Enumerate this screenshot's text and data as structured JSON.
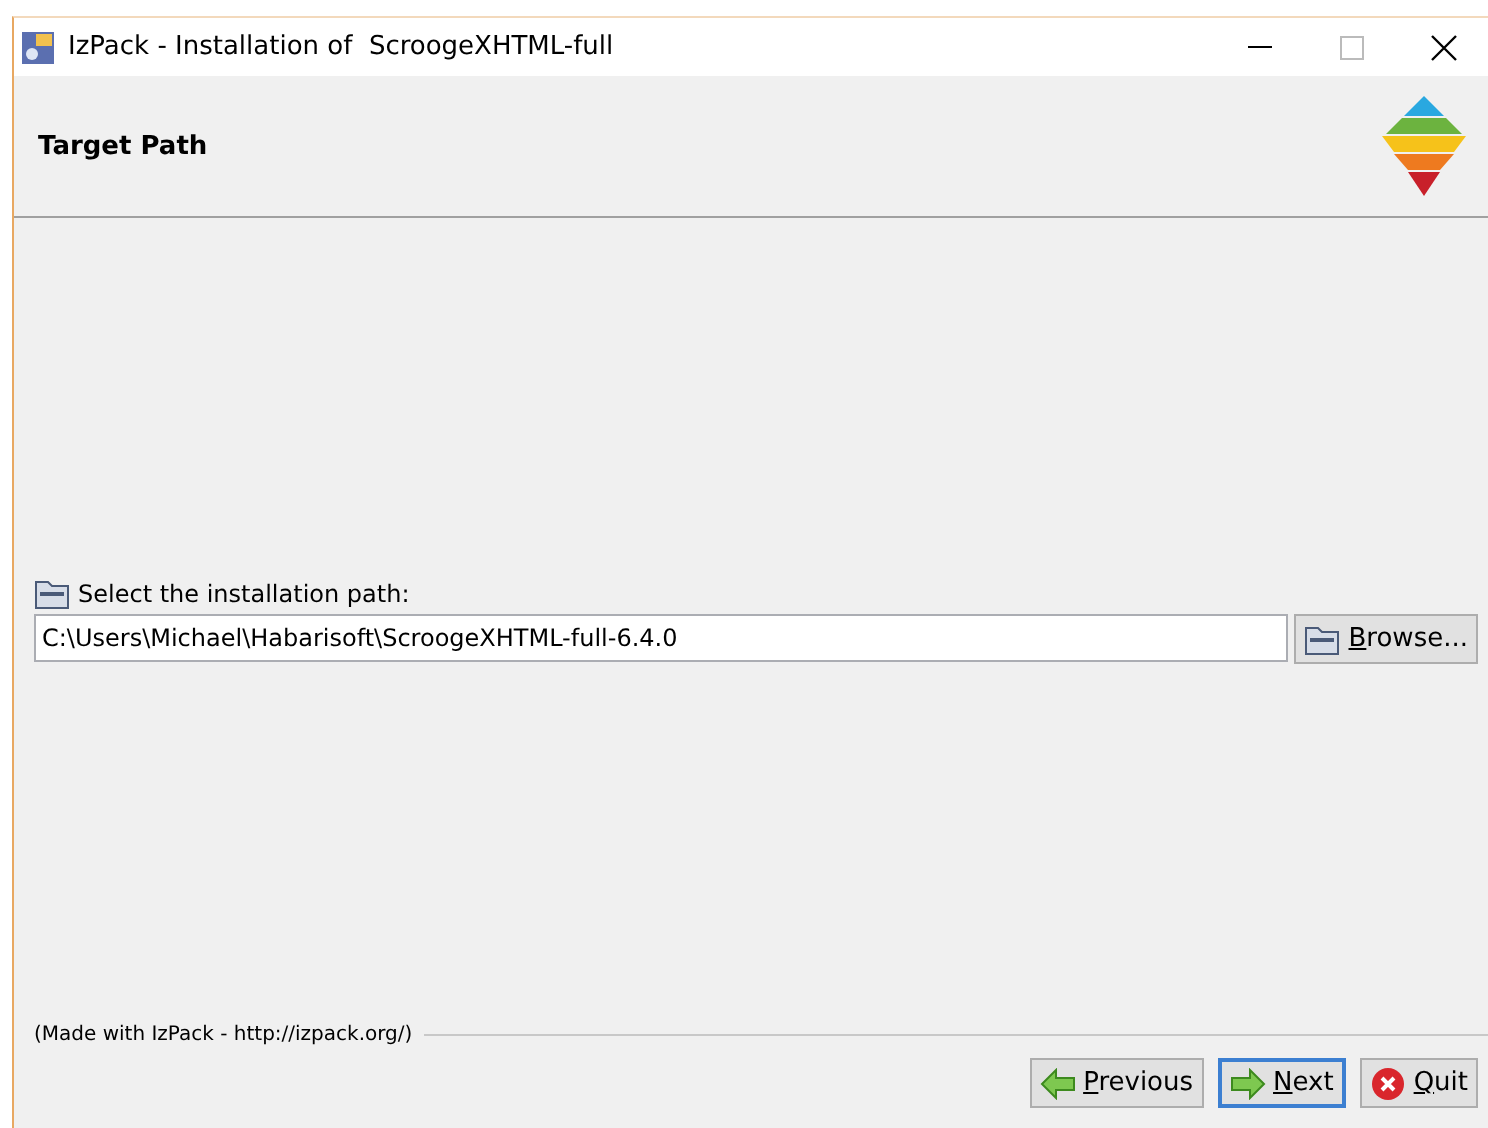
{
  "window": {
    "title": "IzPack - Installation of  ScroogeXHTML-full"
  },
  "header": {
    "title": "Target Path"
  },
  "path": {
    "label": "Select the installation path:",
    "value": "C:\\Users\\Michael\\Habarisoft\\ScroogeXHTML-full-6.4.0",
    "browse": "Browse..."
  },
  "footer": {
    "credit": "(Made with IzPack - http://izpack.org/)"
  },
  "buttons": [
    {
      "kind": "previous",
      "label": "Previous",
      "focused": false
    },
    {
      "kind": "next",
      "label": "Next",
      "focused": true
    },
    {
      "kind": "quit",
      "label": "Quit",
      "focused": false
    }
  ]
}
